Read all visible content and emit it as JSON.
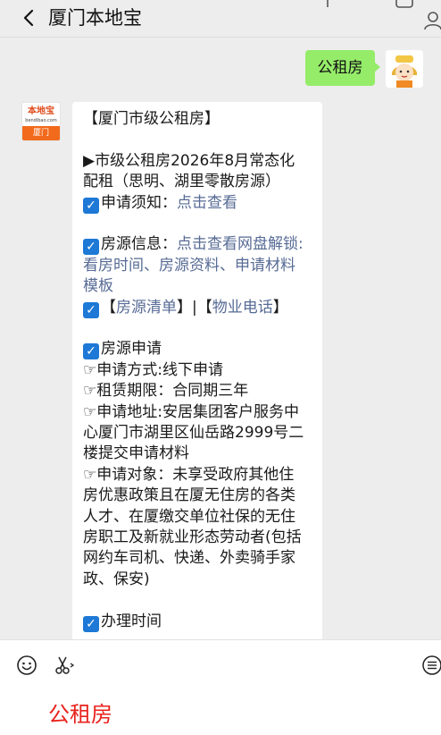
{
  "header": {
    "title": "厦门本地宝"
  },
  "messages": {
    "sent": {
      "text": "公租房"
    },
    "bot": {
      "logo_top": "本地宝",
      "logo_url": "bendibao.com",
      "logo_bottom": "厦门",
      "title": "【厦门市级公租房】",
      "intro_line1": "▶市级公租房2026年8月常态化",
      "intro_line2": "配租（思明、湖里零散房源）",
      "notice_label": "申请须知：",
      "notice_link": "点击查看",
      "info_label": "房源信息：",
      "info_link_line1": "点击查看网盘解锁:",
      "info_link_line2": "看房时间、房源资料、申请材料",
      "info_link_line3": "模板",
      "list_open": "【",
      "list_link": "房源清单",
      "list_sep": "】|【",
      "phone_link": "物业电话",
      "list_close": "】",
      "apply_heading": "房源申请",
      "apply_method": "☞申请方式:线下申请",
      "lease_term": "☞租赁期限：合同期三年",
      "addr_line1": "☞申请地址:安居集团客户服务中",
      "addr_line2": "心厦门市湖里区仙岳路2999号二",
      "addr_line3": "楼提交申请材料",
      "target_line1": "☞申请对象：未享受政府其他住",
      "target_line2": "房优惠政策且在厦无住房的各类",
      "target_line3": "人才、在厦缴交单位社保的无住",
      "target_line4": "房职工及新就业形态劳动者(包括",
      "target_line5": "网约车司机、快递、外卖骑手家",
      "target_line6": "政、保安)",
      "hours_heading": "办理时间"
    }
  },
  "input": {
    "text": "公租房"
  },
  "icons": {
    "back": "chevron-left-icon",
    "emoji": "emoji-icon",
    "scissors": "scissors-icon",
    "menu": "menu-icon"
  },
  "colors": {
    "background": "#ededed",
    "sent_bubble": "#95ec69",
    "link": "#576b95",
    "input_text": "#e8221c",
    "checkbox": "#1d78d6"
  }
}
